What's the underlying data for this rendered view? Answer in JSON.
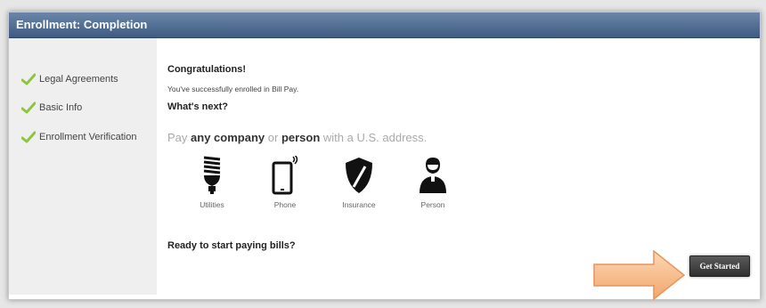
{
  "header": {
    "title": "Enrollment: Completion"
  },
  "sidebar": {
    "steps": [
      {
        "label": "Legal Agreements",
        "icon": "checkmark-icon"
      },
      {
        "label": "Basic Info",
        "icon": "checkmark-icon"
      },
      {
        "label": "Enrollment Verification",
        "icon": "checkmark-icon"
      }
    ]
  },
  "main": {
    "congrats_title": "Congratulations!",
    "enrolled_text": "You've successfully enrolled in Bill Pay.",
    "whats_next": "What's next?",
    "pay_text": {
      "pay": "Pay",
      "any_company": "any company",
      "or": "or",
      "person": "person",
      "with": "with a U.S. address."
    },
    "payees": [
      {
        "label": "Utilities",
        "icon": "lightbulb-icon"
      },
      {
        "label": "Phone",
        "icon": "phone-icon"
      },
      {
        "label": "Insurance",
        "icon": "shield-icon"
      },
      {
        "label": "Person",
        "icon": "person-icon"
      }
    ],
    "ready_text": "Ready to start paying bills?",
    "get_started_label": "Get Started"
  },
  "colors": {
    "header": "#4a6890",
    "check": "#8cc63f",
    "button": "#3a3a3a",
    "arrow": "#f5b27a"
  }
}
